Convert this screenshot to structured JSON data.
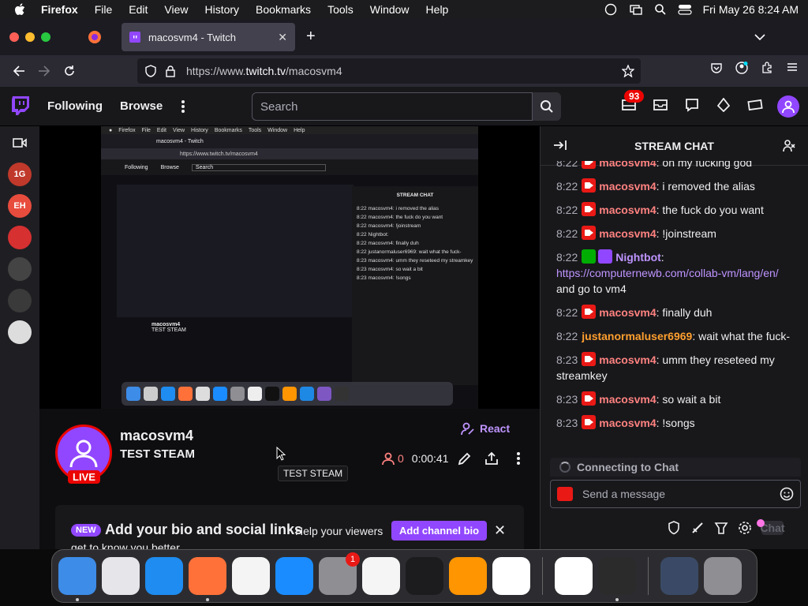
{
  "menubar": {
    "app_name": "Firefox",
    "items": [
      "File",
      "Edit",
      "View",
      "History",
      "Bookmarks",
      "Tools",
      "Window",
      "Help"
    ],
    "datetime": "Fri May 26  8:24 AM"
  },
  "browser": {
    "tab_title": "macosvm4 - Twitch",
    "url_prefix": "https://www.",
    "url_domain": "twitch.tv",
    "url_path": "/macosvm4"
  },
  "twitch_nav": {
    "following": "Following",
    "browse": "Browse",
    "search_placeholder": "Search",
    "notification_count": "93"
  },
  "sidebar": {
    "channels": [
      {
        "label": "1G",
        "color": "#c0392b"
      },
      {
        "label": "EH",
        "color": "#e84c3d"
      },
      {
        "label": "",
        "color": "#d63031"
      },
      {
        "label": "",
        "color": "#444"
      },
      {
        "label": "",
        "color": "#3a3a3a"
      },
      {
        "label": "",
        "color": "#ddd"
      }
    ]
  },
  "channel": {
    "name": "macosvm4",
    "title": "TEST STEAM",
    "live_label": "LIVE",
    "react_label": "React",
    "viewers": "0",
    "uptime": "0:00:41",
    "tooltip": "TEST STEAM"
  },
  "bio_prompt": {
    "badge": "NEW",
    "heading": "Add your bio and social links",
    "sub": "Help your viewers",
    "sub2": "get to know you better",
    "button": "Add channel bio"
  },
  "chat": {
    "header": "STREAM CHAT",
    "messages": [
      {
        "time": "8:22",
        "user": "macosvm4",
        "user_color": "#ff8280",
        "text": "oh my fucking god",
        "icon": "cam"
      },
      {
        "time": "8:22",
        "user": "macosvm4",
        "user_color": "#ff8280",
        "text": "i removed the alias",
        "icon": "cam"
      },
      {
        "time": "8:22",
        "user": "macosvm4",
        "user_color": "#ff8280",
        "text": "the fuck do you want",
        "icon": "cam"
      },
      {
        "time": "8:22",
        "user": "macosvm4",
        "user_color": "#ff8280",
        "text": "!joinstream",
        "icon": "cam"
      },
      {
        "time": "8:22",
        "user": "Nightbot",
        "user_color": "#bf94ff",
        "text": "and go to vm4",
        "link": "https://computernewb.com/collab-vm/lang/en/",
        "icon": "bot"
      },
      {
        "time": "8:22",
        "user": "macosvm4",
        "user_color": "#ff8280",
        "text": "finally duh",
        "icon": "cam"
      },
      {
        "time": "8:22",
        "user": "justanormaluser6969",
        "user_color": "#ff9f2e",
        "text": "wait what the fuck-",
        "icon": "none"
      },
      {
        "time": "8:23",
        "user": "macosvm4",
        "user_color": "#ff8280",
        "text": "umm they reseteed my streamkey",
        "icon": "cam"
      },
      {
        "time": "8:23",
        "user": "macosvm4",
        "user_color": "#ff8280",
        "text": "so wait a bit",
        "icon": "cam"
      },
      {
        "time": "8:23",
        "user": "macosvm4",
        "user_color": "#ff8280",
        "text": "!songs",
        "icon": "cam"
      }
    ],
    "connecting": "Connecting to Chat",
    "input_placeholder": "Send a message",
    "chat_button": "Chat"
  },
  "dock": {
    "apps": [
      {
        "name": "finder",
        "color": "#3d8ce8",
        "running": true
      },
      {
        "name": "launchpad",
        "color": "#e5e5ea",
        "running": false
      },
      {
        "name": "safari",
        "color": "#1e8cf0",
        "running": false
      },
      {
        "name": "firefox",
        "color": "#ff7139",
        "running": true
      },
      {
        "name": "chrome",
        "color": "#f4f4f4",
        "running": false
      },
      {
        "name": "app-store",
        "color": "#1a8cff",
        "running": false
      },
      {
        "name": "system-settings",
        "color": "#8e8e93",
        "running": false,
        "badge": "1"
      },
      {
        "name": "textedit",
        "color": "#f5f5f5",
        "running": false
      },
      {
        "name": "terminal",
        "color": "#1c1c1e",
        "running": false
      },
      {
        "name": "garageband",
        "color": "#ff9500",
        "running": false
      },
      {
        "name": "vscode",
        "color": "#ffffff",
        "running": false
      },
      {
        "name": "visual-studio",
        "color": "#ffffff",
        "running": false
      },
      {
        "name": "obs",
        "color": "#2b2b2b",
        "running": true
      }
    ]
  }
}
